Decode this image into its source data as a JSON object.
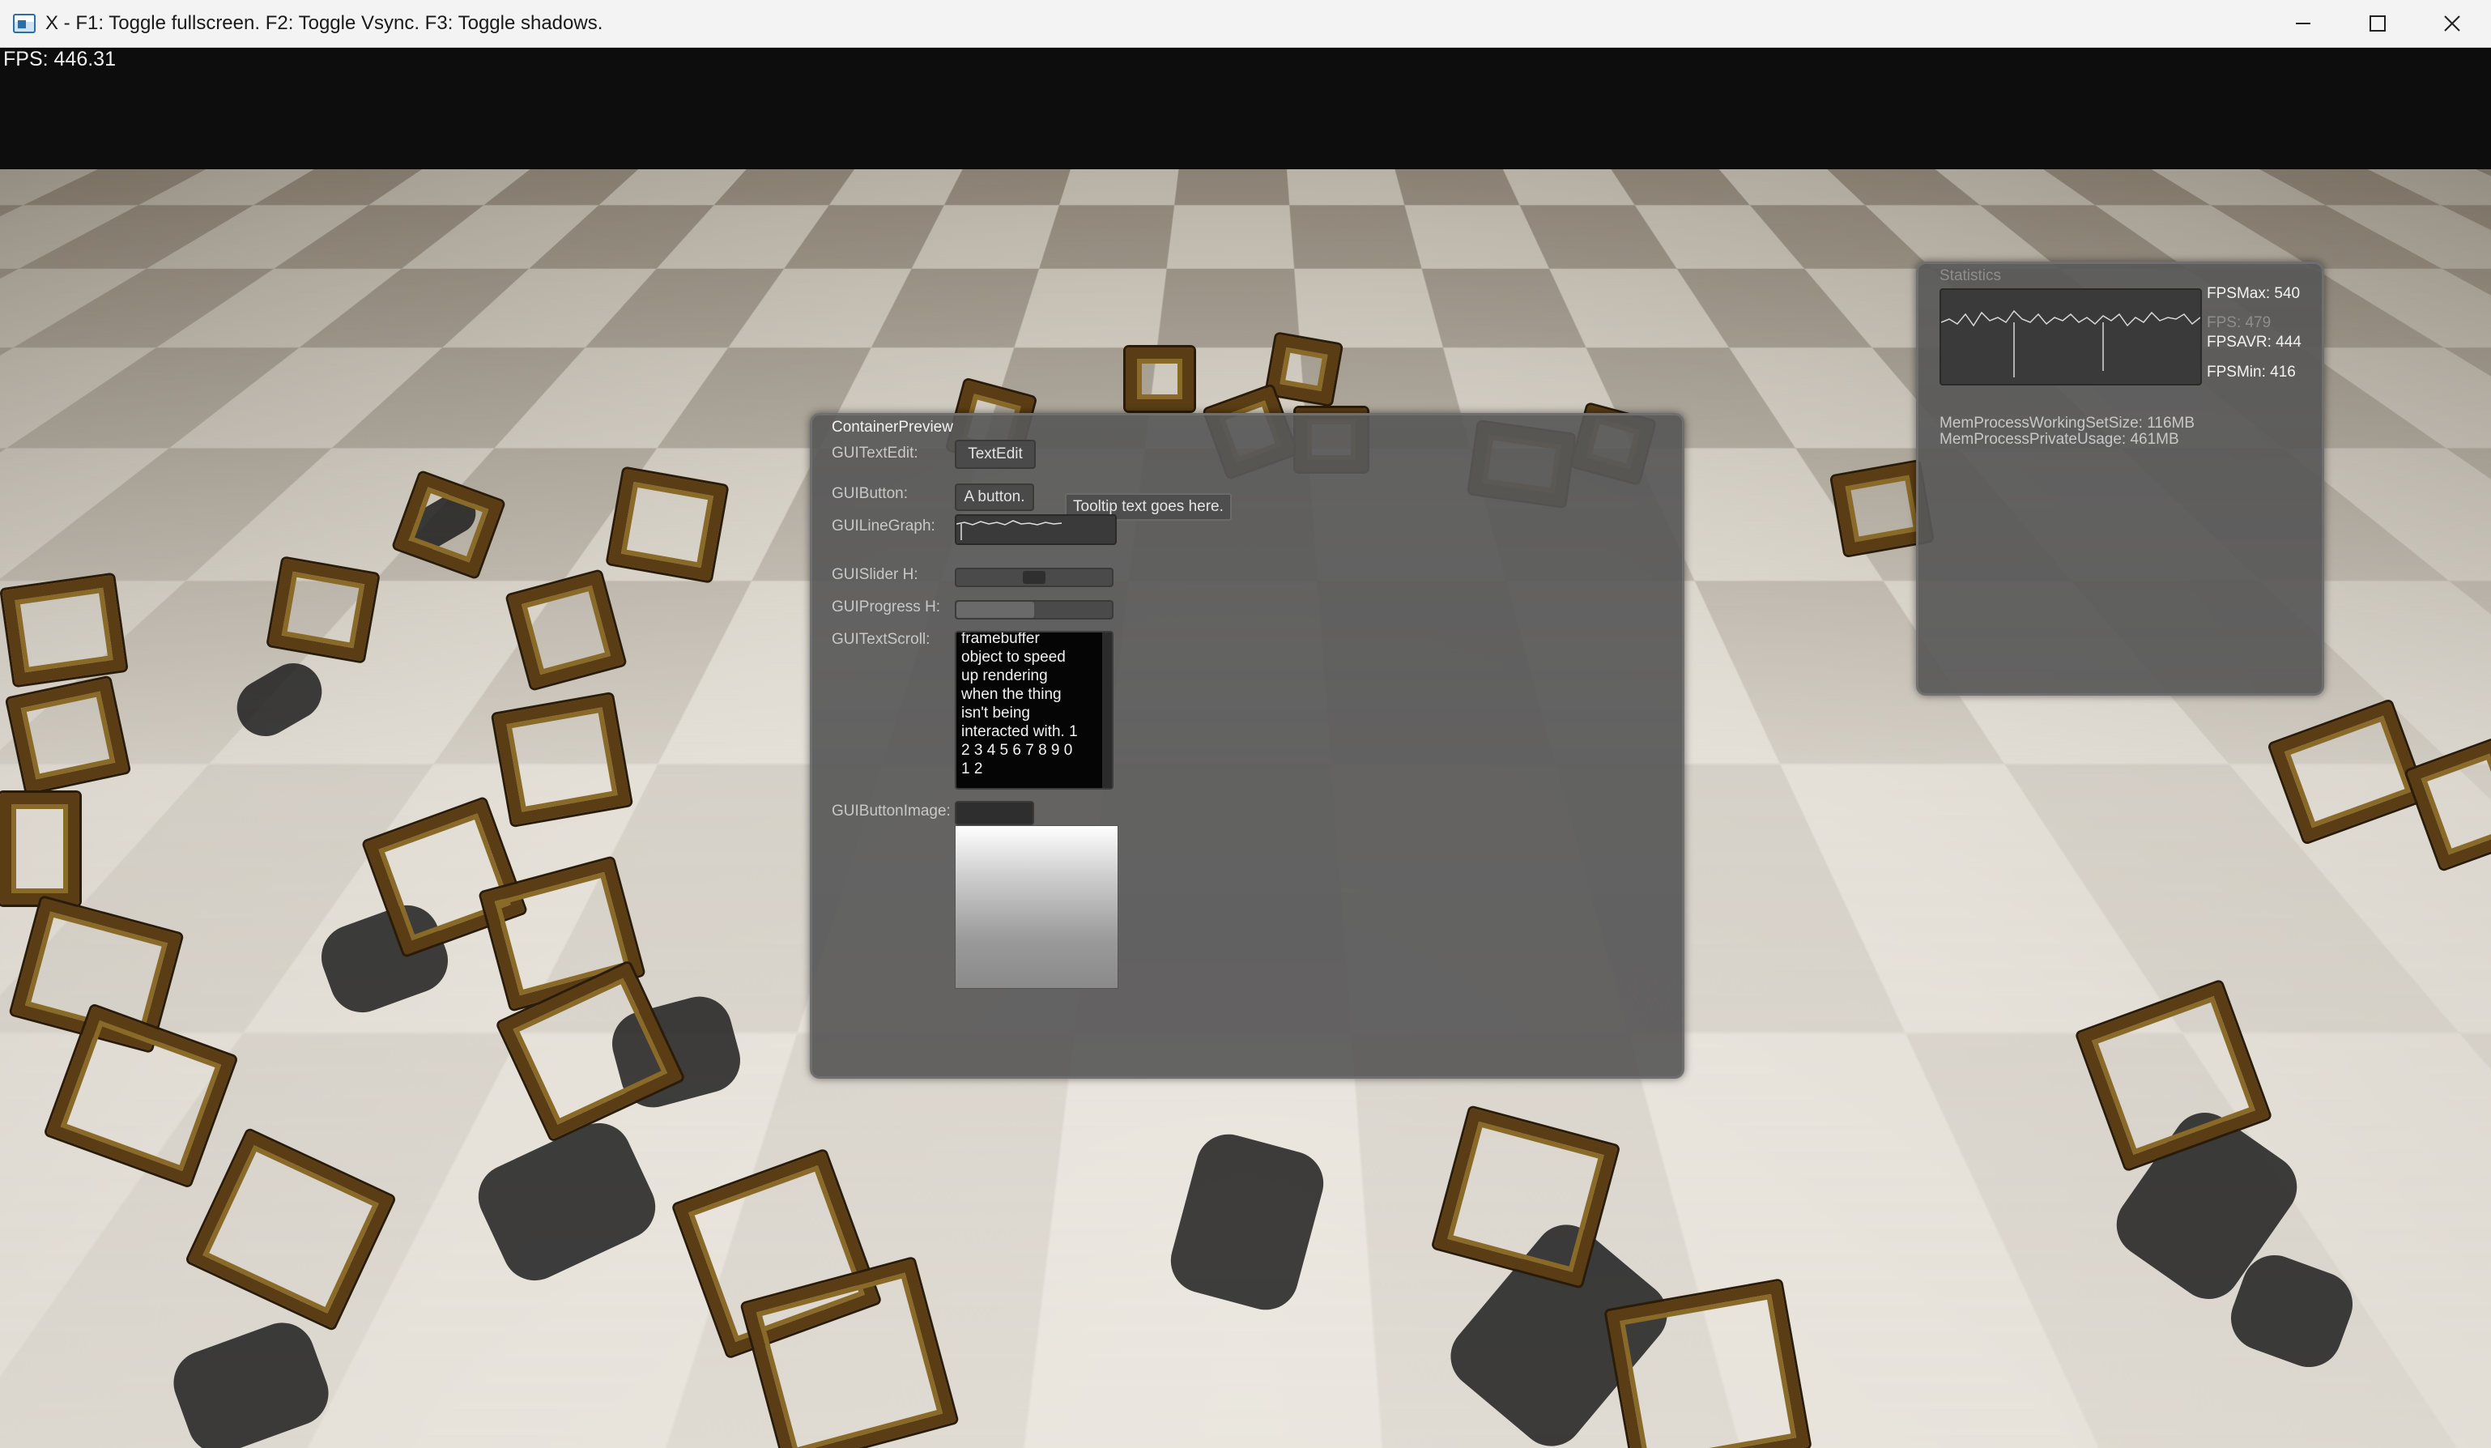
{
  "window": {
    "title": "X - F1: Toggle fullscreen. F2: Toggle Vsync. F3: Toggle shadows.",
    "icon": "app-window-icon",
    "controls": [
      "minimize-icon",
      "maximize-icon",
      "close-icon"
    ]
  },
  "overlay": {
    "fps": "FPS: 446.31"
  },
  "statistics": {
    "title": "Statistics",
    "fps_max": "FPSMax: 540",
    "fps_current": "FPS: 479",
    "fps_avg": "FPSAVR: 444",
    "fps_min": "FPSMin: 416",
    "mem_working_set": "MemProcessWorkingSetSize: 116MB",
    "mem_private": "MemProcessPrivateUsage: 461MB"
  },
  "container": {
    "title": "ContainerPreview",
    "textedit_label": "GUITextEdit:",
    "textedit_value": "TextEdit",
    "button_label": "GUIButton:",
    "button_text": "A button.",
    "tooltip": "Tooltip text goes here.",
    "linegraph_label": "GUILineGraph:",
    "slider_label": "GUISlider H:",
    "slider_value": 0.5,
    "progress_label": "GUIProgress H:",
    "progress_value": 0.5,
    "textscroll_label": "GUITextScroll:",
    "textscroll_lines": [
      "framebuffer",
      "object to speed",
      "up rendering",
      "when the thing",
      "isn't being",
      "interacted with. 1",
      "2 3 4 5 6 7 8 9 0",
      "1 2"
    ],
    "buttonimage_label": "GUIButtonImage:"
  }
}
